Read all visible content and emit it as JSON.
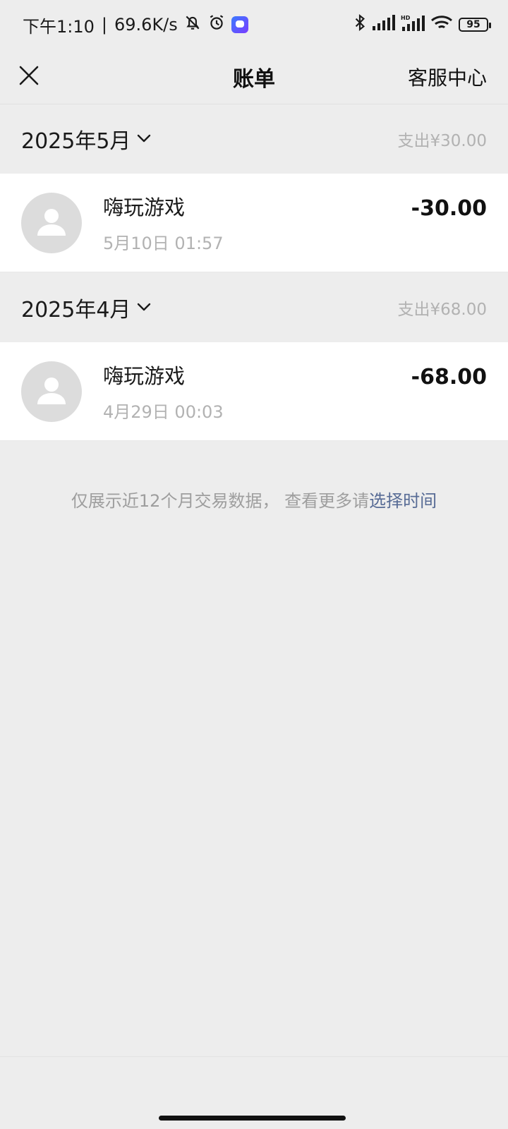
{
  "status_bar": {
    "time": "下午1:10",
    "separator": "|",
    "network_speed": "69.6K/s",
    "battery": "95",
    "icons": [
      "bell-off-icon",
      "alarm-icon",
      "app-icon",
      "bluetooth-icon",
      "signal-icon",
      "signal-hd-icon",
      "wifi-icon",
      "battery-icon"
    ]
  },
  "nav": {
    "title": "账单",
    "service_label": "客服中心",
    "close_icon": "close-icon"
  },
  "months": [
    {
      "label": "2025年5月",
      "spend": "支出¥30.00",
      "items": [
        {
          "name": "嗨玩游戏",
          "time": "5月10日 01:57",
          "amount": "-30.00"
        }
      ]
    },
    {
      "label": "2025年4月",
      "spend": "支出¥68.00",
      "items": [
        {
          "name": "嗨玩游戏",
          "time": "4月29日 00:03",
          "amount": "-68.00"
        }
      ]
    }
  ],
  "footer": {
    "note": "仅展示近12个月交易数据，  查看更多请",
    "link": "选择时间"
  },
  "colors": {
    "background": "#ededed",
    "link": "#576b95",
    "muted_text": "#b2b2b2"
  }
}
